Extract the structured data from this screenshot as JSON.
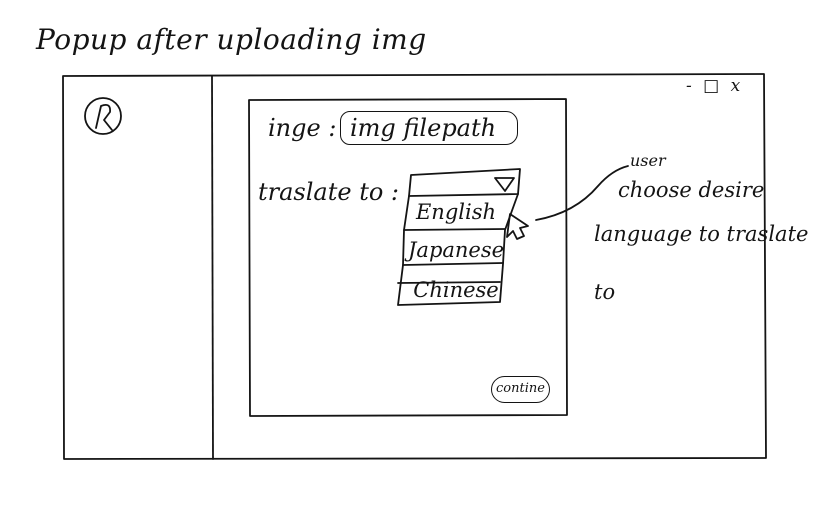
{
  "sketch": {
    "title": "Popup after uploading img",
    "window_controls": "- □ x",
    "popup": {
      "image_label": "inge :",
      "image_field_value": "img filepath",
      "translate_label": "traslate to :",
      "dropdown_arrow_icon": "triangle-down",
      "options": [
        "English",
        "Japanese",
        "Chinese"
      ],
      "continue_label": "contine"
    },
    "annotation": [
      "user",
      "choose desire",
      "language to traslate",
      "to"
    ]
  }
}
